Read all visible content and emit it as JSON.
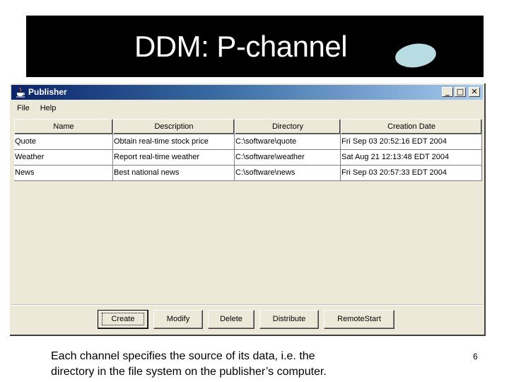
{
  "slide": {
    "title": "DDM: P-channel",
    "caption_line1": "Each channel specifies the source of its data, i.e. the",
    "caption_line2": "directory in the file system on the publisher’s computer.",
    "page_number": "6",
    "accent_blob_color": "#b7dde3"
  },
  "window": {
    "title": "Publisher",
    "icon": "java-coffee-cup-icon",
    "controls": {
      "minimize": "_",
      "maximize": "□",
      "close": "✕"
    },
    "menu": [
      "File",
      "Help"
    ]
  },
  "table": {
    "columns": [
      "Name",
      "Description",
      "Directory",
      "Creation Date"
    ],
    "rows": [
      [
        "Quote",
        "Obtain real-time stock price",
        "C:\\software\\quote",
        "Fri Sep 03 20:52:16 EDT 2004"
      ],
      [
        "Weather",
        "Report real-time weather",
        "C:\\software\\weather",
        "Sat Aug 21 12:13:48 EDT 2004"
      ],
      [
        "News",
        "Best national news",
        "C:\\software\\news",
        "Fri Sep 03 20:57:33 EDT 2004"
      ]
    ]
  },
  "buttons": [
    "Create",
    "Modify",
    "Delete",
    "Distribute",
    "RemoteStart"
  ],
  "colors": {
    "titlebar_start": "#0a246a",
    "titlebar_end": "#a6caf0",
    "window_bg": "#ece9d8"
  }
}
